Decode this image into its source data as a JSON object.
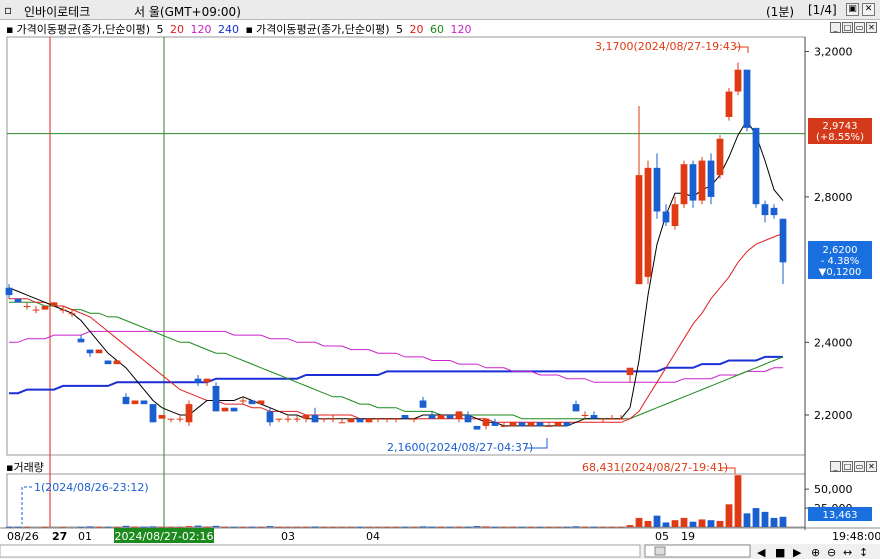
{
  "window": {
    "title": "인바이로테크",
    "market": "서  울(GMT+09:00)",
    "interval": "(1분)",
    "page": "[1/4]"
  },
  "legend": {
    "price_ma": {
      "label": "가격이동평균(종가,단순이평)",
      "periods": [
        "5",
        "20",
        "120",
        "240"
      ]
    },
    "price_ma2": {
      "label": "가격이동평균(종가,단순이평)",
      "periods": [
        "5",
        "20",
        "60",
        "120"
      ]
    },
    "volume_label": "거래량"
  },
  "colors": {
    "up": "#e03a14",
    "down": "#1a5fcf",
    "ma5": "#000000",
    "ma20": "#e41e1e",
    "ma60": "#1b8a1b",
    "ma120": "#cc22cc",
    "ma240": "#1a2fd6",
    "grid_green": "#2a8a2a"
  },
  "price_axis": {
    "ticks": [
      "3,2000",
      "2,8000",
      "2,4000",
      "2,2000"
    ]
  },
  "markers": {
    "current": {
      "price": "2,9743",
      "change": "(+8.55%)"
    },
    "last": {
      "price": "2,6200",
      "pct": "- 4.38%",
      "diff": "▼0,1200"
    },
    "high": "3,1700(2024/08/27-19:43)",
    "low": "2,1600(2024/08/27-04:37)",
    "vol_max": "68,431(2024/08/27-19:41)",
    "vol_min": "1(2024/08/26-23:12)",
    "vol_last": "13,463"
  },
  "volume_axis": {
    "ticks": [
      "50,000",
      "25,000"
    ]
  },
  "time_axis": {
    "labels": [
      "08/26",
      "27",
      "01",
      "03",
      "04",
      "05",
      "19"
    ],
    "cursor": "2024/08/27-02:16",
    "last_time": "19:48:00"
  },
  "chart_data": {
    "type": "candlestick",
    "title": "",
    "xlabel": "",
    "ylabel": "",
    "ylim": [
      2.09,
      3.24
    ],
    "candles": [
      {
        "o": 2.55,
        "h": 2.56,
        "l": 2.52,
        "c": 2.53
      },
      {
        "o": 2.52,
        "h": 2.52,
        "l": 2.51,
        "c": 2.51
      },
      {
        "o": 2.5,
        "h": 2.51,
        "l": 2.49,
        "c": 2.5
      },
      {
        "o": 2.49,
        "h": 2.5,
        "l": 2.48,
        "c": 2.49
      },
      {
        "o": 2.49,
        "h": 2.5,
        "l": 2.49,
        "c": 2.5
      },
      {
        "o": 2.5,
        "h": 2.51,
        "l": 2.5,
        "c": 2.51
      },
      {
        "o": 2.49,
        "h": 2.5,
        "l": 2.48,
        "c": 2.49
      },
      {
        "o": 2.48,
        "h": 2.49,
        "l": 2.47,
        "c": 2.48
      },
      {
        "o": 2.41,
        "h": 2.42,
        "l": 2.4,
        "c": 2.4
      },
      {
        "o": 2.38,
        "h": 2.38,
        "l": 2.36,
        "c": 2.37
      },
      {
        "o": 2.37,
        "h": 2.38,
        "l": 2.37,
        "c": 2.38
      },
      {
        "o": 2.35,
        "h": 2.35,
        "l": 2.34,
        "c": 2.34
      },
      {
        "o": 2.34,
        "h": 2.35,
        "l": 2.34,
        "c": 2.35
      },
      {
        "o": 2.25,
        "h": 2.26,
        "l": 2.23,
        "c": 2.23
      },
      {
        "o": 2.23,
        "h": 2.24,
        "l": 2.23,
        "c": 2.24
      },
      {
        "o": 2.24,
        "h": 2.24,
        "l": 2.23,
        "c": 2.23
      },
      {
        "o": 2.23,
        "h": 2.23,
        "l": 2.18,
        "c": 2.18
      },
      {
        "o": 2.19,
        "h": 2.2,
        "l": 2.19,
        "c": 2.2
      },
      {
        "o": 2.19,
        "h": 2.19,
        "l": 2.18,
        "c": 2.19
      },
      {
        "o": 2.19,
        "h": 2.2,
        "l": 2.18,
        "c": 2.19
      },
      {
        "o": 2.18,
        "h": 2.24,
        "l": 2.17,
        "c": 2.23
      },
      {
        "o": 2.3,
        "h": 2.31,
        "l": 2.28,
        "c": 2.29
      },
      {
        "o": 2.29,
        "h": 2.3,
        "l": 2.28,
        "c": 2.3
      },
      {
        "o": 2.28,
        "h": 2.29,
        "l": 2.21,
        "c": 2.21
      },
      {
        "o": 2.21,
        "h": 2.22,
        "l": 2.21,
        "c": 2.22
      },
      {
        "o": 2.22,
        "h": 2.22,
        "l": 2.21,
        "c": 2.21
      },
      {
        "o": 2.24,
        "h": 2.25,
        "l": 2.23,
        "c": 2.24
      },
      {
        "o": 2.24,
        "h": 2.24,
        "l": 2.23,
        "c": 2.23
      },
      {
        "o": 2.23,
        "h": 2.24,
        "l": 2.23,
        "c": 2.24
      },
      {
        "o": 2.21,
        "h": 2.22,
        "l": 2.17,
        "c": 2.18
      },
      {
        "o": 2.19,
        "h": 2.19,
        "l": 2.18,
        "c": 2.19
      },
      {
        "o": 2.19,
        "h": 2.2,
        "l": 2.18,
        "c": 2.19
      },
      {
        "o": 2.19,
        "h": 2.2,
        "l": 2.18,
        "c": 2.19
      },
      {
        "o": 2.19,
        "h": 2.2,
        "l": 2.18,
        "c": 2.2
      },
      {
        "o": 2.2,
        "h": 2.22,
        "l": 2.18,
        "c": 2.18
      },
      {
        "o": 2.19,
        "h": 2.19,
        "l": 2.18,
        "c": 2.19
      },
      {
        "o": 2.19,
        "h": 2.2,
        "l": 2.18,
        "c": 2.19
      },
      {
        "o": 2.18,
        "h": 2.19,
        "l": 2.18,
        "c": 2.18
      },
      {
        "o": 2.18,
        "h": 2.19,
        "l": 2.18,
        "c": 2.19
      },
      {
        "o": 2.19,
        "h": 2.19,
        "l": 2.18,
        "c": 2.18
      },
      {
        "o": 2.18,
        "h": 2.19,
        "l": 2.18,
        "c": 2.19
      },
      {
        "o": 2.19,
        "h": 2.19,
        "l": 2.18,
        "c": 2.19
      },
      {
        "o": 2.19,
        "h": 2.19,
        "l": 2.18,
        "c": 2.19
      },
      {
        "o": 2.19,
        "h": 2.19,
        "l": 2.18,
        "c": 2.19
      },
      {
        "o": 2.2,
        "h": 2.2,
        "l": 2.19,
        "c": 2.19
      },
      {
        "o": 2.19,
        "h": 2.19,
        "l": 2.18,
        "c": 2.19
      },
      {
        "o": 2.24,
        "h": 2.25,
        "l": 2.22,
        "c": 2.22
      },
      {
        "o": 2.2,
        "h": 2.21,
        "l": 2.19,
        "c": 2.19
      },
      {
        "o": 2.19,
        "h": 2.2,
        "l": 2.19,
        "c": 2.2
      },
      {
        "o": 2.2,
        "h": 2.2,
        "l": 2.19,
        "c": 2.19
      },
      {
        "o": 2.19,
        "h": 2.21,
        "l": 2.18,
        "c": 2.21
      },
      {
        "o": 2.2,
        "h": 2.21,
        "l": 2.18,
        "c": 2.18
      },
      {
        "o": 2.17,
        "h": 2.17,
        "l": 2.16,
        "c": 2.16
      },
      {
        "o": 2.17,
        "h": 2.19,
        "l": 2.16,
        "c": 2.19
      },
      {
        "o": 2.18,
        "h": 2.19,
        "l": 2.17,
        "c": 2.17
      },
      {
        "o": 2.17,
        "h": 2.18,
        "l": 2.17,
        "c": 2.17
      },
      {
        "o": 2.17,
        "h": 2.18,
        "l": 2.17,
        "c": 2.18
      },
      {
        "o": 2.18,
        "h": 2.18,
        "l": 2.17,
        "c": 2.17
      },
      {
        "o": 2.17,
        "h": 2.18,
        "l": 2.17,
        "c": 2.18
      },
      {
        "o": 2.18,
        "h": 2.18,
        "l": 2.17,
        "c": 2.17
      },
      {
        "o": 2.17,
        "h": 2.18,
        "l": 2.17,
        "c": 2.17
      },
      {
        "o": 2.17,
        "h": 2.18,
        "l": 2.17,
        "c": 2.18
      },
      {
        "o": 2.18,
        "h": 2.18,
        "l": 2.17,
        "c": 2.17
      },
      {
        "o": 2.23,
        "h": 2.24,
        "l": 2.21,
        "c": 2.21
      },
      {
        "o": 2.2,
        "h": 2.21,
        "l": 2.19,
        "c": 2.2
      },
      {
        "o": 2.2,
        "h": 2.21,
        "l": 2.19,
        "c": 2.19
      },
      {
        "o": 2.19,
        "h": 2.19,
        "l": 2.18,
        "c": 2.19
      },
      {
        "o": 2.19,
        "h": 2.2,
        "l": 2.19,
        "c": 2.19
      },
      {
        "o": 2.19,
        "h": 2.2,
        "l": 2.19,
        "c": 2.19
      },
      {
        "o": 2.31,
        "h": 2.33,
        "l": 2.29,
        "c": 2.33
      },
      {
        "o": 2.56,
        "h": 3.05,
        "l": 2.56,
        "c": 2.86
      },
      {
        "o": 2.58,
        "h": 2.9,
        "l": 2.56,
        "c": 2.88
      },
      {
        "o": 2.88,
        "h": 2.92,
        "l": 2.74,
        "c": 2.76
      },
      {
        "o": 2.76,
        "h": 2.78,
        "l": 2.72,
        "c": 2.73
      },
      {
        "o": 2.72,
        "h": 2.8,
        "l": 2.71,
        "c": 2.78
      },
      {
        "o": 2.78,
        "h": 2.9,
        "l": 2.77,
        "c": 2.89
      },
      {
        "o": 2.89,
        "h": 2.9,
        "l": 2.77,
        "c": 2.79
      },
      {
        "o": 2.79,
        "h": 2.91,
        "l": 2.78,
        "c": 2.9
      },
      {
        "o": 2.9,
        "h": 2.92,
        "l": 2.78,
        "c": 2.8
      },
      {
        "o": 2.86,
        "h": 2.97,
        "l": 2.85,
        "c": 2.96
      },
      {
        "o": 3.02,
        "h": 3.1,
        "l": 3.01,
        "c": 3.09
      },
      {
        "o": 3.09,
        "h": 3.17,
        "l": 3.08,
        "c": 3.15
      },
      {
        "o": 3.15,
        "h": 3.15,
        "l": 2.98,
        "c": 2.99
      },
      {
        "o": 2.99,
        "h": 2.99,
        "l": 2.77,
        "c": 2.78
      },
      {
        "o": 2.78,
        "h": 2.79,
        "l": 2.73,
        "c": 2.75
      },
      {
        "o": 2.77,
        "h": 2.78,
        "l": 2.74,
        "c": 2.75
      },
      {
        "o": 2.74,
        "h": 2.74,
        "l": 2.56,
        "c": 2.62
      }
    ],
    "ma5": [
      2.55,
      2.54,
      2.53,
      2.52,
      2.51,
      2.5,
      2.49,
      2.48,
      2.46,
      2.43,
      2.4,
      2.37,
      2.35,
      2.33,
      2.3,
      2.27,
      2.24,
      2.22,
      2.21,
      2.2,
      2.2,
      2.22,
      2.24,
      2.24,
      2.24,
      2.24,
      2.25,
      2.24,
      2.23,
      2.22,
      2.21,
      2.2,
      2.2,
      2.19,
      2.19,
      2.19,
      2.19,
      2.19,
      2.19,
      2.19,
      2.19,
      2.19,
      2.19,
      2.19,
      2.19,
      2.19,
      2.2,
      2.2,
      2.2,
      2.2,
      2.2,
      2.2,
      2.19,
      2.18,
      2.18,
      2.17,
      2.17,
      2.17,
      2.17,
      2.17,
      2.17,
      2.17,
      2.17,
      2.18,
      2.19,
      2.19,
      2.19,
      2.19,
      2.19,
      2.22,
      2.35,
      2.53,
      2.67,
      2.75,
      2.81,
      2.81,
      2.8,
      2.82,
      2.83,
      2.86,
      2.91,
      2.97,
      3.01,
      2.97,
      2.9,
      2.82,
      2.79
    ],
    "ma20": [
      2.52,
      2.52,
      2.52,
      2.51,
      2.51,
      2.5,
      2.5,
      2.49,
      2.48,
      2.47,
      2.45,
      2.43,
      2.41,
      2.39,
      2.37,
      2.35,
      2.33,
      2.31,
      2.29,
      2.27,
      2.26,
      2.25,
      2.24,
      2.24,
      2.23,
      2.23,
      2.23,
      2.22,
      2.22,
      2.21,
      2.21,
      2.21,
      2.21,
      2.2,
      2.2,
      2.2,
      2.2,
      2.2,
      2.2,
      2.19,
      2.19,
      2.19,
      2.19,
      2.19,
      2.19,
      2.19,
      2.19,
      2.19,
      2.19,
      2.19,
      2.19,
      2.19,
      2.19,
      2.19,
      2.18,
      2.18,
      2.18,
      2.18,
      2.18,
      2.18,
      2.18,
      2.18,
      2.18,
      2.18,
      2.18,
      2.18,
      2.18,
      2.18,
      2.18,
      2.19,
      2.21,
      2.25,
      2.29,
      2.33,
      2.37,
      2.41,
      2.45,
      2.48,
      2.52,
      2.55,
      2.58,
      2.62,
      2.65,
      2.67,
      2.68,
      2.69,
      2.7
    ],
    "ma60": [
      2.51,
      2.51,
      2.51,
      2.51,
      2.5,
      2.5,
      2.5,
      2.49,
      2.49,
      2.48,
      2.48,
      2.47,
      2.47,
      2.46,
      2.45,
      2.44,
      2.43,
      2.42,
      2.41,
      2.4,
      2.4,
      2.39,
      2.38,
      2.37,
      2.37,
      2.36,
      2.35,
      2.34,
      2.33,
      2.32,
      2.31,
      2.3,
      2.29,
      2.28,
      2.27,
      2.26,
      2.25,
      2.25,
      2.24,
      2.23,
      2.23,
      2.22,
      2.22,
      2.22,
      2.21,
      2.21,
      2.21,
      2.21,
      2.2,
      2.2,
      2.2,
      2.2,
      2.2,
      2.2,
      2.2,
      2.2,
      2.2,
      2.19,
      2.19,
      2.19,
      2.19,
      2.19,
      2.19,
      2.19,
      2.19,
      2.19,
      2.19,
      2.19,
      2.19,
      2.19,
      2.2,
      2.21,
      2.22,
      2.23,
      2.24,
      2.25,
      2.26,
      2.27,
      2.28,
      2.29,
      2.3,
      2.31,
      2.32,
      2.33,
      2.34,
      2.35,
      2.36
    ],
    "ma120": [
      2.4,
      2.4,
      2.41,
      2.41,
      2.41,
      2.42,
      2.42,
      2.42,
      2.42,
      2.43,
      2.43,
      2.43,
      2.43,
      2.43,
      2.43,
      2.43,
      2.43,
      2.43,
      2.43,
      2.43,
      2.43,
      2.43,
      2.43,
      2.43,
      2.43,
      2.42,
      2.42,
      2.42,
      2.42,
      2.41,
      2.41,
      2.41,
      2.4,
      2.4,
      2.4,
      2.39,
      2.39,
      2.39,
      2.38,
      2.38,
      2.38,
      2.37,
      2.37,
      2.37,
      2.36,
      2.36,
      2.36,
      2.35,
      2.35,
      2.35,
      2.34,
      2.34,
      2.34,
      2.33,
      2.33,
      2.33,
      2.32,
      2.32,
      2.32,
      2.31,
      2.31,
      2.31,
      2.3,
      2.3,
      2.3,
      2.29,
      2.29,
      2.29,
      2.29,
      2.29,
      2.29,
      2.29,
      2.29,
      2.29,
      2.29,
      2.3,
      2.3,
      2.3,
      2.3,
      2.31,
      2.31,
      2.31,
      2.32,
      2.32,
      2.32,
      2.33,
      2.33
    ],
    "ma240": [
      2.26,
      2.26,
      2.27,
      2.27,
      2.27,
      2.27,
      2.28,
      2.28,
      2.28,
      2.28,
      2.28,
      2.28,
      2.29,
      2.29,
      2.29,
      2.29,
      2.29,
      2.29,
      2.29,
      2.29,
      2.29,
      2.29,
      2.29,
      2.3,
      2.3,
      2.3,
      2.3,
      2.3,
      2.3,
      2.3,
      2.3,
      2.3,
      2.3,
      2.31,
      2.31,
      2.31,
      2.31,
      2.31,
      2.31,
      2.31,
      2.31,
      2.31,
      2.32,
      2.32,
      2.32,
      2.32,
      2.32,
      2.32,
      2.32,
      2.32,
      2.32,
      2.32,
      2.32,
      2.32,
      2.32,
      2.32,
      2.32,
      2.32,
      2.32,
      2.32,
      2.32,
      2.32,
      2.32,
      2.32,
      2.32,
      2.32,
      2.32,
      2.32,
      2.32,
      2.32,
      2.32,
      2.32,
      2.32,
      2.33,
      2.33,
      2.33,
      2.33,
      2.34,
      2.34,
      2.34,
      2.35,
      2.35,
      2.35,
      2.35,
      2.36,
      2.36,
      2.36
    ],
    "volume": [
      300,
      200,
      150,
      0,
      100,
      0,
      100,
      0,
      200,
      800,
      300,
      200,
      100,
      1500,
      400,
      300,
      800,
      200,
      100,
      100,
      1200,
      1800,
      500,
      1500,
      200,
      100,
      100,
      200,
      100,
      1200,
      200,
      100,
      100,
      200,
      600,
      100,
      100,
      200,
      100,
      100,
      100,
      100,
      100,
      100,
      200,
      100,
      800,
      300,
      200,
      100,
      400,
      300,
      1200,
      800,
      200,
      100,
      200,
      100,
      100,
      100,
      100,
      100,
      200,
      900,
      300,
      200,
      100,
      100,
      100,
      2500,
      12000,
      8000,
      15000,
      6000,
      9000,
      12000,
      7000,
      10000,
      9000,
      8000,
      30000,
      68431,
      18000,
      25000,
      20000,
      12000,
      13463
    ],
    "volume_ylim": [
      0,
      70000
    ]
  }
}
